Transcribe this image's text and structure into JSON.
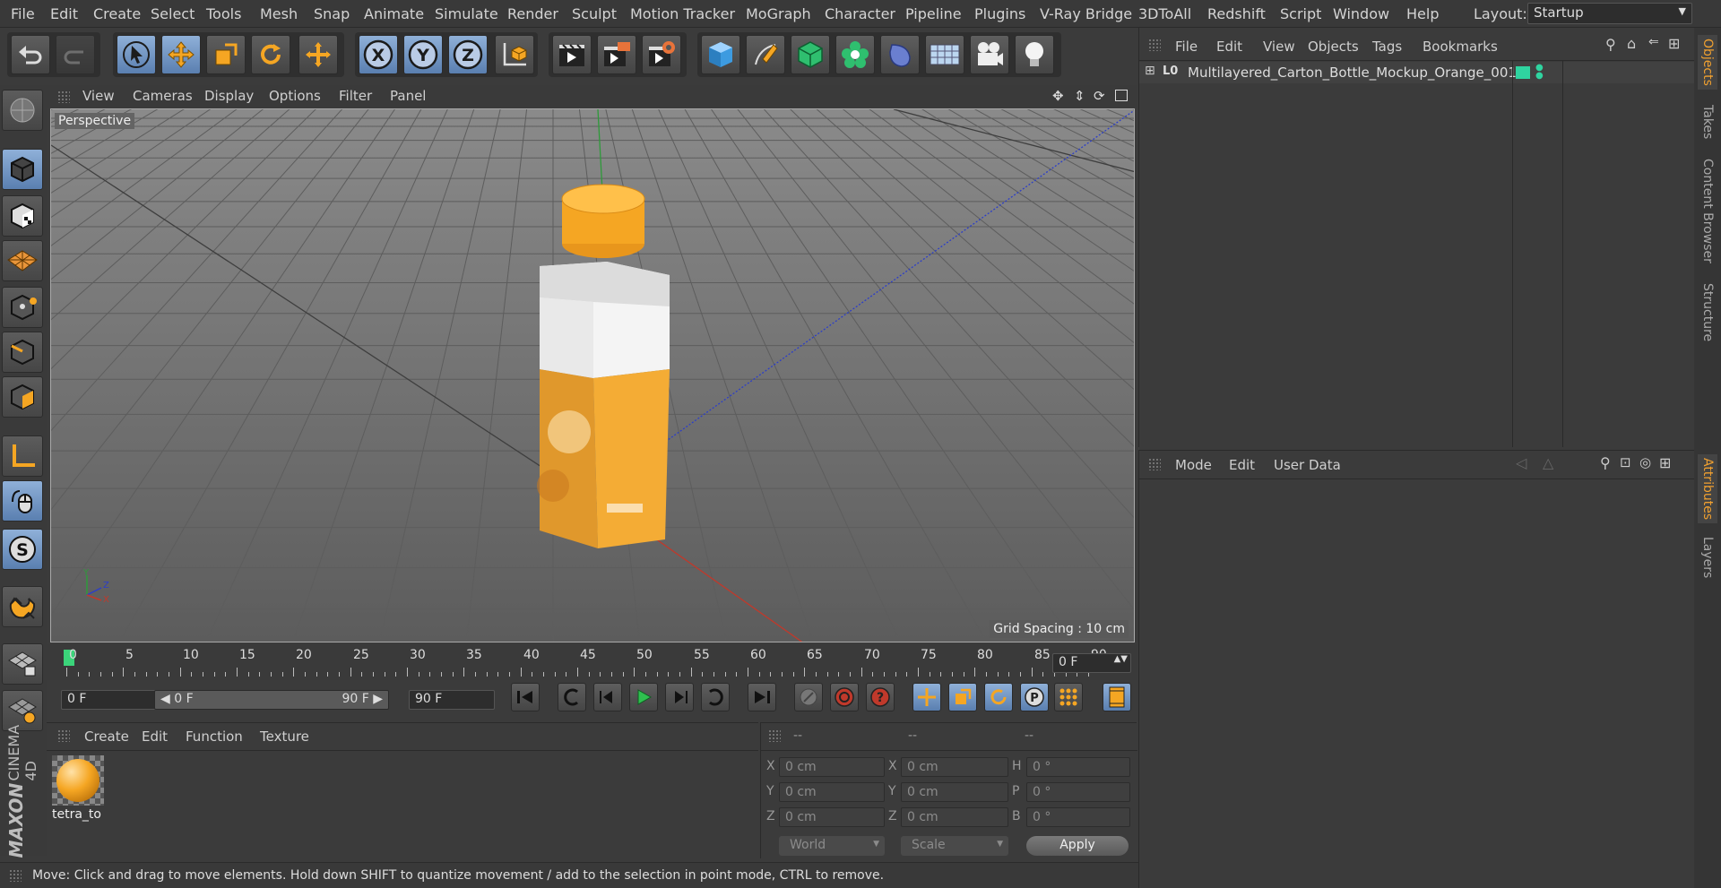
{
  "menu": [
    "File",
    "Edit",
    "Create",
    "Select",
    "Tools",
    "Mesh",
    "Snap",
    "Animate",
    "Simulate",
    "Render",
    "Sculpt",
    "Motion Tracker",
    "MoGraph",
    "Character",
    "Pipeline",
    "Plugins",
    "V-Ray Bridge",
    "3DToAll",
    "Redshift",
    "Script",
    "Window",
    "Help"
  ],
  "layout": {
    "label": "Layout:",
    "value": "Startup"
  },
  "toolbar_icons": [
    "undo-icon",
    "redo-icon",
    "select-arrow-icon",
    "move-icon",
    "scale-icon",
    "rotate-icon",
    "live-selection-icon",
    "x-axis-icon",
    "y-axis-icon",
    "z-axis-icon",
    "coordinate-system-icon",
    "render-view-icon",
    "render-picture-viewer-icon",
    "render-settings-icon",
    "cube-icon",
    "pen-icon",
    "subdivision-icon",
    "cloner-icon",
    "deformer-icon",
    "floor-icon",
    "camera-icon",
    "light-icon"
  ],
  "axis_letters": {
    "x": "X",
    "y": "Y",
    "z": "Z"
  },
  "viewport": {
    "menu": [
      "View",
      "Cameras",
      "Display",
      "Options",
      "Filter",
      "Panel"
    ],
    "label": "Perspective",
    "grid_spacing": "Grid Spacing : 10 cm",
    "gizmo": {
      "y": "Y",
      "z": "Z",
      "x": "X"
    }
  },
  "object_manager": {
    "menu": [
      "File",
      "Edit",
      "View",
      "Objects",
      "Tags",
      "Bookmarks"
    ],
    "object_name": "Multilayered_Carton_Bottle_Mockup_Orange_001",
    "tag_color": "#2fd4a0"
  },
  "attributes": {
    "menu": [
      "Mode",
      "Edit",
      "User Data"
    ]
  },
  "side_tabs_top": [
    "Objects",
    "Takes",
    "Content Browser",
    "Structure"
  ],
  "side_tabs_bottom": [
    "Attributes",
    "Layers"
  ],
  "timeline": {
    "ticks": [
      "0",
      "5",
      "10",
      "15",
      "20",
      "25",
      "30",
      "35",
      "40",
      "45",
      "50",
      "55",
      "60",
      "65",
      "70",
      "75",
      "80",
      "85",
      "90"
    ],
    "current_frame": "0 F",
    "start": "0 F",
    "range_start": "0 F",
    "range_end": "90 F",
    "end": "90 F",
    "playhead_fraction": 0
  },
  "material_manager": {
    "menu": [
      "Create",
      "Edit",
      "Function",
      "Texture"
    ],
    "material_name": "tetra_to"
  },
  "coordinates": {
    "headers": [
      "--",
      "--",
      "--"
    ],
    "rows": [
      {
        "l1": "X",
        "v1": "0 cm",
        "l2": "X",
        "v2": "0 cm",
        "l3": "H",
        "v3": "0 °"
      },
      {
        "l1": "Y",
        "v1": "0 cm",
        "l2": "Y",
        "v2": "0 cm",
        "l3": "P",
        "v3": "0 °"
      },
      {
        "l1": "Z",
        "v1": "0 cm",
        "l2": "Z",
        "v2": "0 cm",
        "l3": "B",
        "v3": "0 °"
      }
    ],
    "mode": "World",
    "scale": "Scale",
    "apply": "Apply"
  },
  "brand": {
    "line1": "MAXON",
    "line2": "CINEMA 4D"
  },
  "status": "Move: Click and drag to move elements. Hold down SHIFT to quantize movement / add to the selection in point mode, CTRL to remove.",
  "colors": {
    "accent": "#f0a030",
    "ui_blue": "#7a9ccc",
    "x_axis": "#c0392b",
    "y_axis": "#27ae60",
    "z_axis": "#2c3ec8"
  }
}
